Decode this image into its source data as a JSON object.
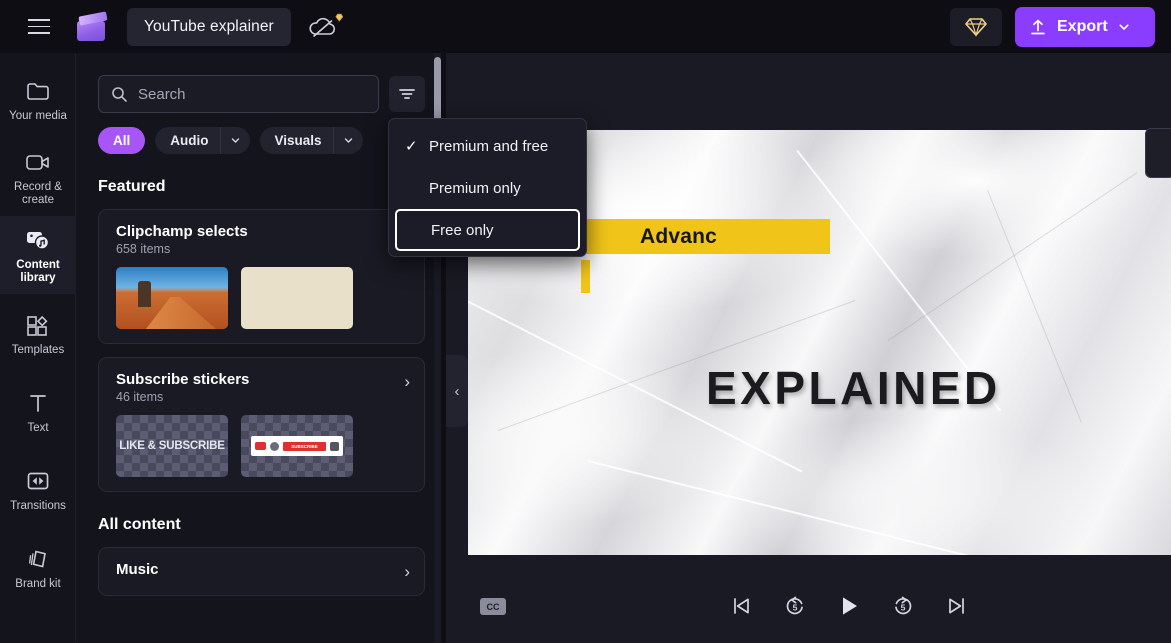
{
  "header": {
    "menu_icon": "hamburger-icon",
    "logo_icon": "clipchamp-logo-icon",
    "project_title": "YouTube explainer",
    "cloud_icon": "cloud-off-icon",
    "gem_icon": "premium-diamond-icon",
    "export_label": "Export",
    "export_icon": "upload-arrow-icon",
    "export_chevron": "chevron-down-icon",
    "export_color": "#8b3dff"
  },
  "sidebar": {
    "items": [
      {
        "label": "Your media",
        "icon": "folder-icon",
        "active": false
      },
      {
        "label": "Record & create",
        "icon": "video-camera-icon",
        "active": false
      },
      {
        "label": "Content library",
        "icon": "content-library-icon",
        "active": true
      },
      {
        "label": "Templates",
        "icon": "templates-icon",
        "active": false
      },
      {
        "label": "Text",
        "icon": "text-icon",
        "active": false
      },
      {
        "label": "Transitions",
        "icon": "transitions-icon",
        "active": false
      },
      {
        "label": "Brand kit",
        "icon": "brand-kit-icon",
        "active": false
      }
    ]
  },
  "library": {
    "search": {
      "placeholder": "Search",
      "value": "",
      "icon": "search-icon"
    },
    "filter_button_icon": "filter-icon",
    "pills": [
      {
        "label": "All",
        "active": true,
        "has_chevron": false
      },
      {
        "label": "Audio",
        "active": false,
        "has_chevron": true
      },
      {
        "label": "Visuals",
        "active": false,
        "has_chevron": true
      }
    ],
    "featured_title": "Featured",
    "featured_cards": [
      {
        "name": "Clipchamp selects",
        "count": "658 items"
      },
      {
        "name": "Subscribe stickers",
        "count": "46 items"
      }
    ],
    "sticker_thumb_text": "LIKE & SUBSCRIBE",
    "sticker_sub_text": "SUBSCRIBE",
    "all_content_title": "All content",
    "all_content_items": [
      {
        "name": "Music"
      }
    ]
  },
  "dropdown": {
    "items": [
      {
        "label": "Premium and free",
        "checked": true,
        "focused": false
      },
      {
        "label": "Premium only",
        "checked": false,
        "focused": false
      },
      {
        "label": "Free only",
        "checked": false,
        "focused": true
      }
    ],
    "check_glyph": "✓"
  },
  "preview": {
    "overlay_highlight_text": "Advanc",
    "overlay_title_text": "EXPLAINED",
    "highlight_color": "#f0c419",
    "collapse_icon": "chevron-left-icon",
    "cc_label": "CC",
    "controls": [
      {
        "name": "skip-to-start-button",
        "icon": "skip-previous-icon"
      },
      {
        "name": "rewind-5s-button",
        "icon": "replay-5-icon",
        "label": "5"
      },
      {
        "name": "play-button",
        "icon": "play-icon"
      },
      {
        "name": "forward-5s-button",
        "icon": "forward-5-icon",
        "label": "5"
      },
      {
        "name": "skip-to-end-button",
        "icon": "skip-next-icon"
      }
    ]
  }
}
